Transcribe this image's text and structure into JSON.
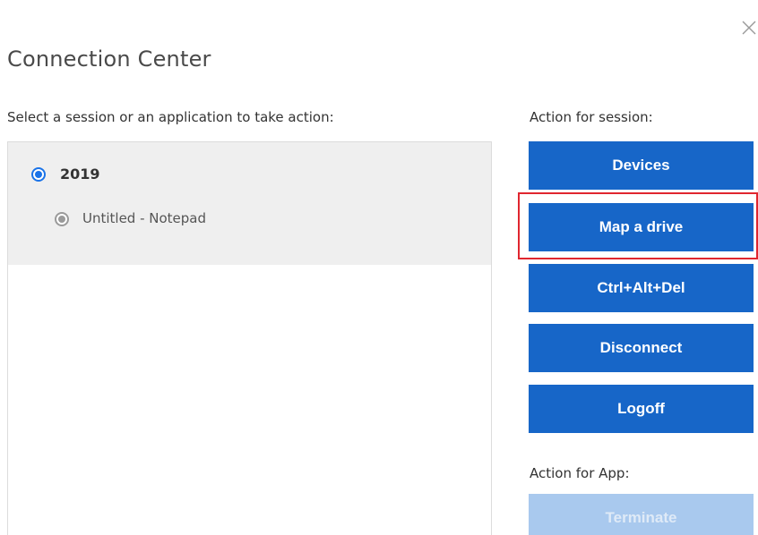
{
  "window": {
    "title": "Connection Center",
    "close_icon": "close-icon"
  },
  "sessions_panel": {
    "label": "Select a session or an application to take action:",
    "sessions": [
      {
        "name": "2019",
        "selected": true,
        "applications": [
          {
            "name": "Untitled - Notepad",
            "selected": false
          }
        ]
      }
    ]
  },
  "session_actions": {
    "label": "Action for session:",
    "buttons": {
      "devices": "Devices",
      "map_drive": "Map a drive",
      "ctrl_alt_del": "Ctrl+Alt+Del",
      "disconnect": "Disconnect",
      "logoff": "Logoff"
    }
  },
  "app_actions": {
    "label": "Action for App:",
    "buttons": {
      "terminate": "Terminate"
    },
    "terminate_enabled": false
  },
  "colors": {
    "primary_button": "#1766c8",
    "disabled_button": "#a9c9ee",
    "highlight": "#e0262f",
    "radio_selected": "#1a73e8",
    "panel_group_bg": "#efefef"
  }
}
